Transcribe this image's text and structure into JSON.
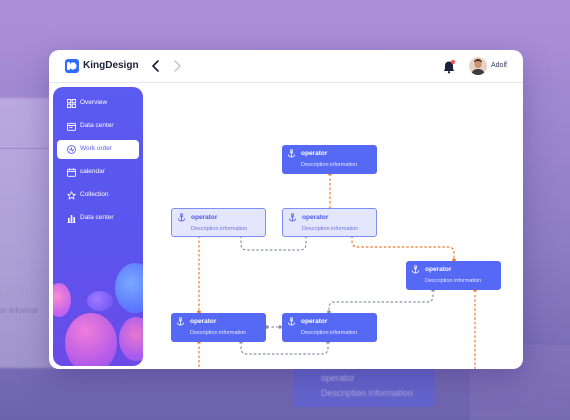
{
  "app": {
    "brand": "KingDesign",
    "username": "Adolf"
  },
  "header": {
    "prev_icon": "chevron-left-icon",
    "next_icon": "chevron-right-icon",
    "bell_icon": "bell-icon"
  },
  "sidebar": {
    "items": [
      {
        "label": "Overview",
        "icon": "grid-icon",
        "active": false
      },
      {
        "label": "Data center",
        "icon": "calendar-card-icon",
        "active": false
      },
      {
        "label": "Work order",
        "icon": "work-order-icon",
        "active": true
      },
      {
        "label": "calendar",
        "icon": "calendar-icon",
        "active": false
      },
      {
        "label": "Collection",
        "icon": "star-icon",
        "active": false
      },
      {
        "label": "Data center",
        "icon": "bar-chart-icon",
        "active": false
      }
    ]
  },
  "flow": {
    "nodes": [
      {
        "title": "operator",
        "desc": "Description information"
      },
      {
        "title": "operator",
        "desc": "Description information"
      },
      {
        "title": "operator",
        "desc": "Description information"
      },
      {
        "title": "operator",
        "desc": "Description information"
      },
      {
        "title": "operator",
        "desc": "Description information"
      },
      {
        "title": "operator",
        "desc": "Description information"
      }
    ]
  },
  "background": {
    "ghost_node_title": "operator",
    "ghost_node_desc": "Description information",
    "ghost_text1": "r",
    "ghost_text2": "on informat"
  },
  "colors": {
    "accent": "#5669f5",
    "sidebar": "#5b5bf0",
    "wire_orange": "#ee7a25",
    "wire_gray": "#8a8fa6"
  }
}
